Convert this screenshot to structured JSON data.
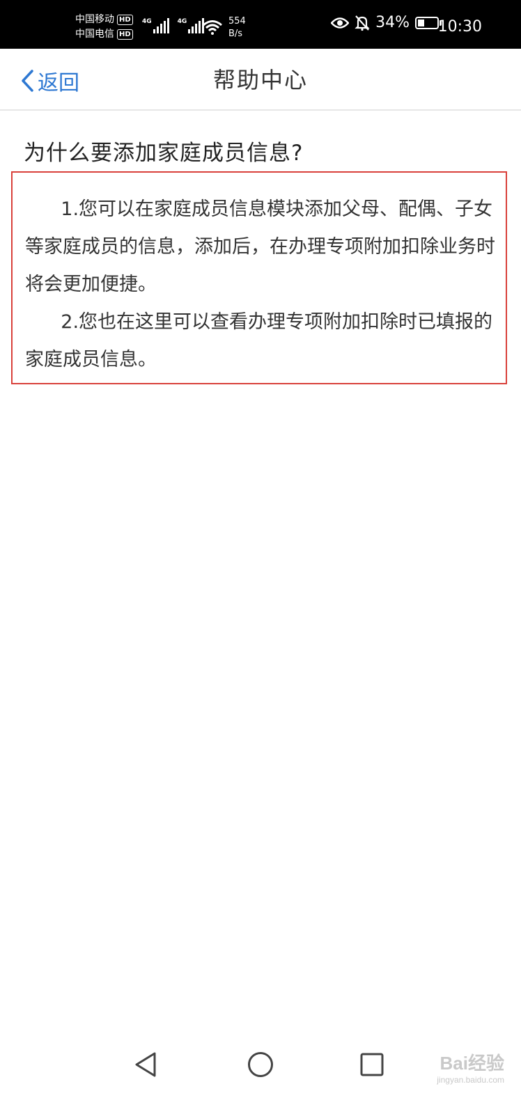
{
  "status_bar": {
    "carrier1": "中国移动",
    "carrier2": "中国电信",
    "hd_badge": "HD",
    "network_type": "4G",
    "net_speed_value": "554",
    "net_speed_unit": "B/s",
    "battery_percent": "34%",
    "battery_level": 0.34,
    "time": "10:30"
  },
  "header": {
    "back_label": "返回",
    "title": "帮助中心"
  },
  "content": {
    "question": "为什么要添加家庭成员信息?",
    "answers": [
      "1.您可以在家庭成员信息模块添加父母、配偶、子女等家庭成员的信息，添加后，在办理专项附加扣除业务时将会更加便捷。",
      "2.您也在这里可以查看办理专项附加扣除时已填报的家庭成员信息。"
    ]
  },
  "colors": {
    "accent": "#2e78d2",
    "highlight_border": "#d9403a"
  },
  "nav_bar": {
    "icons": [
      "back-triangle-icon",
      "home-circle-icon",
      "recents-square-icon"
    ]
  },
  "watermark": {
    "main": "Bai经验",
    "sub": "jingyan.baidu.com"
  }
}
